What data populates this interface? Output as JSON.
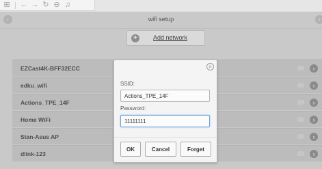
{
  "toolbar": {
    "icons": [
      "grid-icon",
      "back-arrow-icon",
      "forward-arrow-icon",
      "refresh-icon",
      "stop-icon",
      "music-icon"
    ],
    "glyphs": {
      "grid": "⊞",
      "back": "←",
      "forward": "→",
      "refresh": "↻",
      "stop": "⊖",
      "music": "♫"
    }
  },
  "header": {
    "title": "wifi setup",
    "left_icon": "‹",
    "right_icon": "›"
  },
  "add_network": {
    "icon": "+",
    "label": "Add network"
  },
  "networks": [
    {
      "name": "EZCast4K-BFF32ECC"
    },
    {
      "name": "edku_wifi"
    },
    {
      "name": "Actions_TPE_14F"
    },
    {
      "name": "Home WiFi"
    },
    {
      "name": "Stan-Asus AP"
    },
    {
      "name": "dlink-123"
    }
  ],
  "dialog": {
    "close_icon": "×",
    "ssid_label": "SSID:",
    "ssid_value": "Actions_TPE_14F",
    "password_label": "Password:",
    "password_value": "11111111",
    "ok_label": "OK",
    "cancel_label": "Cancel",
    "forget_label": "Forget"
  },
  "row_chevron": "›",
  "colors": {
    "header_bg": "#c9c9c9",
    "row_bg": "#bcbcbc",
    "dialog_bg": "#f4f4f4",
    "focus_border": "#6ea6dc"
  }
}
